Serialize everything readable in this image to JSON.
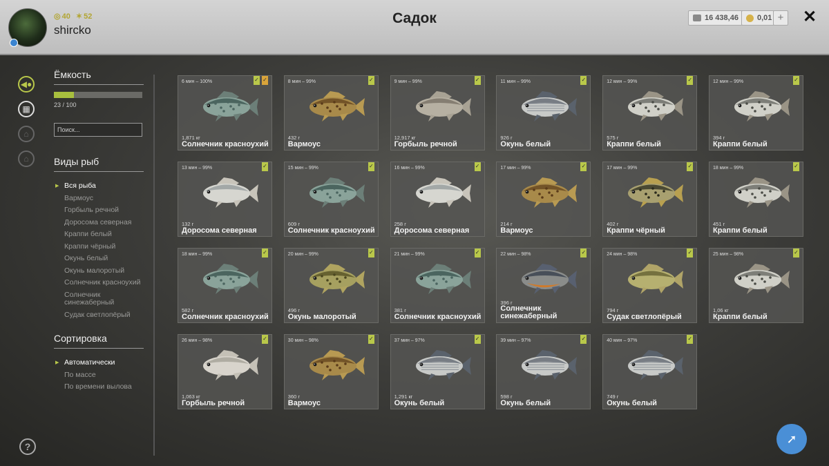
{
  "header": {
    "title": "Садок",
    "username": "shircko",
    "stat1": "40",
    "stat2": "52",
    "silver": "16 438,46",
    "gold": "0,01",
    "plus": "+",
    "close": "✕"
  },
  "panel": {
    "capacity_title": "Ёмкость",
    "capacity_text": "23 / 100",
    "capacity_fraction": 0.23,
    "search_placeholder": "Поиск...",
    "species_title": "Виды рыб",
    "species": [
      "Вся рыба",
      "Вармоус",
      "Горбыль речной",
      "Доросома северная",
      "Краппи белый",
      "Краппи чёрный",
      "Окунь белый",
      "Окунь малоротый",
      "Солнечник красноухий",
      "Солнечник синежаберный",
      "Судак светлопёрый"
    ],
    "sort_title": "Сортировка",
    "sorts": [
      "Автоматически",
      "По массе",
      "По времени вылова"
    ]
  },
  "colors": {
    "accent": "#b9c84a",
    "orange": "#d9a43a",
    "blue": "#4a8fd6"
  },
  "fish": [
    {
      "time": "6 мин – 100%",
      "weight": "1,871 кг",
      "name": "Солнечник красноухий",
      "kind": "sunfish",
      "badges": [
        "green",
        "orange"
      ]
    },
    {
      "time": "8 мин – 99%",
      "weight": "432 г",
      "name": "Вармоус",
      "kind": "warmouth",
      "badges": [
        "green"
      ]
    },
    {
      "time": "9 мин – 99%",
      "weight": "12,917 кг",
      "name": "Горбыль речной",
      "kind": "drum",
      "badges": [
        "green"
      ]
    },
    {
      "time": "11 мин – 99%",
      "weight": "926 г",
      "name": "Окунь белый",
      "kind": "whitebass",
      "badges": [
        "green"
      ]
    },
    {
      "time": "12 мин – 99%",
      "weight": "575 г",
      "name": "Краппи белый",
      "kind": "crappie",
      "badges": [
        "green"
      ]
    },
    {
      "time": "12 мин – 99%",
      "weight": "394 г",
      "name": "Краппи белый",
      "kind": "crappie",
      "badges": [
        "green"
      ]
    },
    {
      "time": "13 мин – 99%",
      "weight": "132 г",
      "name": "Доросома северная",
      "kind": "shad",
      "badges": [
        "green"
      ]
    },
    {
      "time": "15 мин – 99%",
      "weight": "609 г",
      "name": "Солнечник красноухий",
      "kind": "sunfish",
      "badges": [
        "green"
      ]
    },
    {
      "time": "16 мин – 99%",
      "weight": "258 г",
      "name": "Доросома северная",
      "kind": "shad",
      "badges": [
        "green"
      ]
    },
    {
      "time": "17 мин – 99%",
      "weight": "214 г",
      "name": "Вармоус",
      "kind": "warmouth",
      "badges": [
        "green"
      ]
    },
    {
      "time": "17 мин – 99%",
      "weight": "402 г",
      "name": "Краппи чёрный",
      "kind": "blackcrappie",
      "badges": [
        "green"
      ]
    },
    {
      "time": "18 мин – 99%",
      "weight": "451 г",
      "name": "Краппи белый",
      "kind": "crappie",
      "badges": [
        "green"
      ]
    },
    {
      "time": "18 мин – 99%",
      "weight": "582 г",
      "name": "Солнечник красноухий",
      "kind": "sunfish",
      "badges": [
        "green"
      ]
    },
    {
      "time": "20 мин – 99%",
      "weight": "496 г",
      "name": "Окунь малоротый",
      "kind": "bass",
      "badges": [
        "green"
      ]
    },
    {
      "time": "21 мин – 99%",
      "weight": "381 г",
      "name": "Солнечник красноухий",
      "kind": "sunfish",
      "badges": [
        "green"
      ]
    },
    {
      "time": "22 мин – 98%",
      "weight": "396 г",
      "name": "Солнечник синежаберный",
      "kind": "bluegill",
      "badges": [
        "green"
      ],
      "two_line": true
    },
    {
      "time": "24 мин – 98%",
      "weight": "794 г",
      "name": "Судак светлопёрый",
      "kind": "walleye",
      "badges": [
        "green"
      ]
    },
    {
      "time": "25 мин – 98%",
      "weight": "1,06 кг",
      "name": "Краппи белый",
      "kind": "crappie",
      "badges": [
        "green"
      ]
    },
    {
      "time": "26 мин – 98%",
      "weight": "1,063 кг",
      "name": "Горбыль речной",
      "kind": "drumwhite",
      "badges": [
        "green"
      ]
    },
    {
      "time": "30 мин – 98%",
      "weight": "360 г",
      "name": "Вармоус",
      "kind": "warmouth",
      "badges": [
        "green"
      ]
    },
    {
      "time": "37 мин – 97%",
      "weight": "1,291 кг",
      "name": "Окунь белый",
      "kind": "whitebass",
      "badges": [
        "green"
      ]
    },
    {
      "time": "39 мин – 97%",
      "weight": "598 г",
      "name": "Окунь белый",
      "kind": "whitebass",
      "badges": [
        "green"
      ]
    },
    {
      "time": "40 мин – 97%",
      "weight": "749 г",
      "name": "Окунь белый",
      "kind": "whitebass",
      "badges": [
        "green"
      ]
    }
  ]
}
